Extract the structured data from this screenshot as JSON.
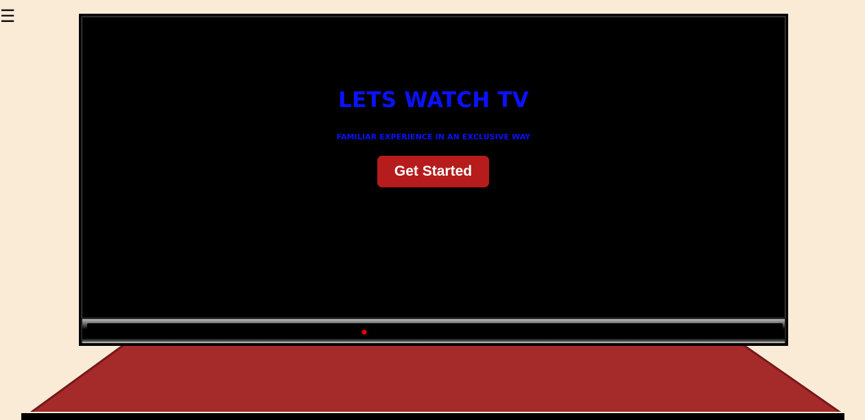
{
  "navigation": {
    "menu_icon": "hamburger-icon",
    "menu_glyph": "☰"
  },
  "tv": {
    "title": "LETS WATCH TV",
    "subtitle": "FAMILIAR EXPERIENCE IN AN EXCLUSIVE WAY",
    "cta_label": "Get Started"
  },
  "colors": {
    "background": "#faebd7",
    "screen": "#000000",
    "title_text": "#0a12ff",
    "button": "#b61c1c",
    "button_text": "#ffffff",
    "stand": "#a52a2a",
    "power_led": "#ff0000"
  }
}
